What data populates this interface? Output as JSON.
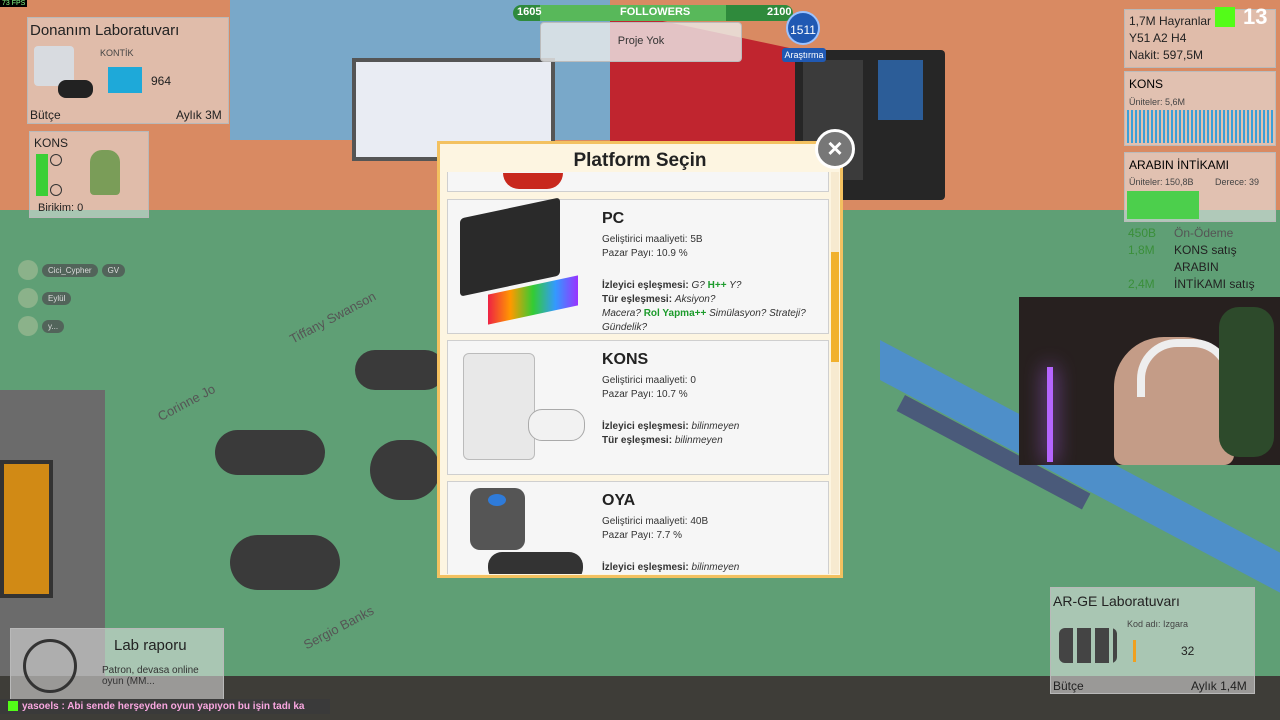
{
  "top_left_fps": "73 FPS",
  "hardware_lab": {
    "title": "Donanım Laboratuvarı",
    "subtitle": "KONTİK",
    "value": "964",
    "budget_label": "Bütçe",
    "monthly": "Aylık 3M"
  },
  "kons_panel": {
    "title": "KONS",
    "savings": "Birikim: 0"
  },
  "users": [
    {
      "name": "Cici_Cypher",
      "tag": "GV"
    },
    {
      "name": "Eylül"
    },
    {
      "name": "y..."
    }
  ],
  "followers": {
    "min": "1605",
    "label": "FOLLOWERS",
    "max": "2100",
    "progress": 0.66
  },
  "research": {
    "count": "1511",
    "label": "Araştırma"
  },
  "project": {
    "label": "Proje Yok"
  },
  "dialog": {
    "title": "Platform Seçin",
    "close": "×",
    "scroll_position": 0.2,
    "platforms": [
      {
        "name": "PC",
        "cost": "Geliştirici maaliyeti: 5B",
        "share": "Pazar Payı: 10.9 %",
        "audience_label": "İzleyici eşleşmesi:",
        "audience_value_pre": "G? ",
        "audience_value_hl": "H++",
        "audience_value_post": " Y?",
        "genre_label": "Tür eşleşmesi:",
        "genre_value": "Aksiyon?",
        "genre_line2_pre": "Macera? ",
        "genre_line2_hl": "Rol Yapma++",
        "genre_line2_post": " Simülasyon? Strateji?",
        "genre_line3": "Gündelik?"
      },
      {
        "name": "KONS",
        "cost": "Geliştirici maaliyeti: 0",
        "share": "Pazar Payı: 10.7 %",
        "audience_label": "İzleyici eşleşmesi:",
        "audience_value": "bilinmeyen",
        "genre_label": "Tür eşleşmesi:",
        "genre_value": "bilinmeyen"
      },
      {
        "name": "OYA",
        "cost": "Geliştirici maaliyeti: 40B",
        "share": "Pazar Payı: 7.7 %",
        "audience_label": "İzleyici eşleşmesi:",
        "audience_value": "bilinmeyen"
      }
    ]
  },
  "stats": {
    "fans": "1,7M Hayranlar",
    "date": "Y51 A2 H4",
    "cash": "Nakit: 597,5M",
    "top_right_num": "13"
  },
  "kons_sales_chart": {
    "title": "KONS",
    "units": "Üniteler: 5,6M"
  },
  "game_panel": {
    "title": "ARABIN İNTİKAMI",
    "units": "Üniteler: 150,8B",
    "rank": "Derece: 39",
    "progress": 0.5
  },
  "sales_list": [
    {
      "amount": "450B",
      "label": "Ön-Ödeme"
    },
    {
      "amount": "1,8M",
      "label": "KONS satış"
    },
    {
      "amount": "",
      "label": "ARABIN"
    },
    {
      "amount": "2,4M",
      "label": "İNTİKAMI satış"
    }
  ],
  "ar_ge": {
    "title": "AR-GE Laboratuvarı",
    "code": "Kod adı: Izgara",
    "value": "32",
    "budget": "Bütçe",
    "monthly": "Aylık 1,4M"
  },
  "lab_report": {
    "title": "Lab raporu",
    "text": "Patron, devasa online oyun (MM..."
  },
  "staff_labels": [
    "Tiffany Swanson",
    "Corinne Jo",
    "Sergio Banks"
  ],
  "chat": {
    "message": "yasoels : Abi sende herşeyden oyun yapıyon bu işin tadı ka"
  }
}
